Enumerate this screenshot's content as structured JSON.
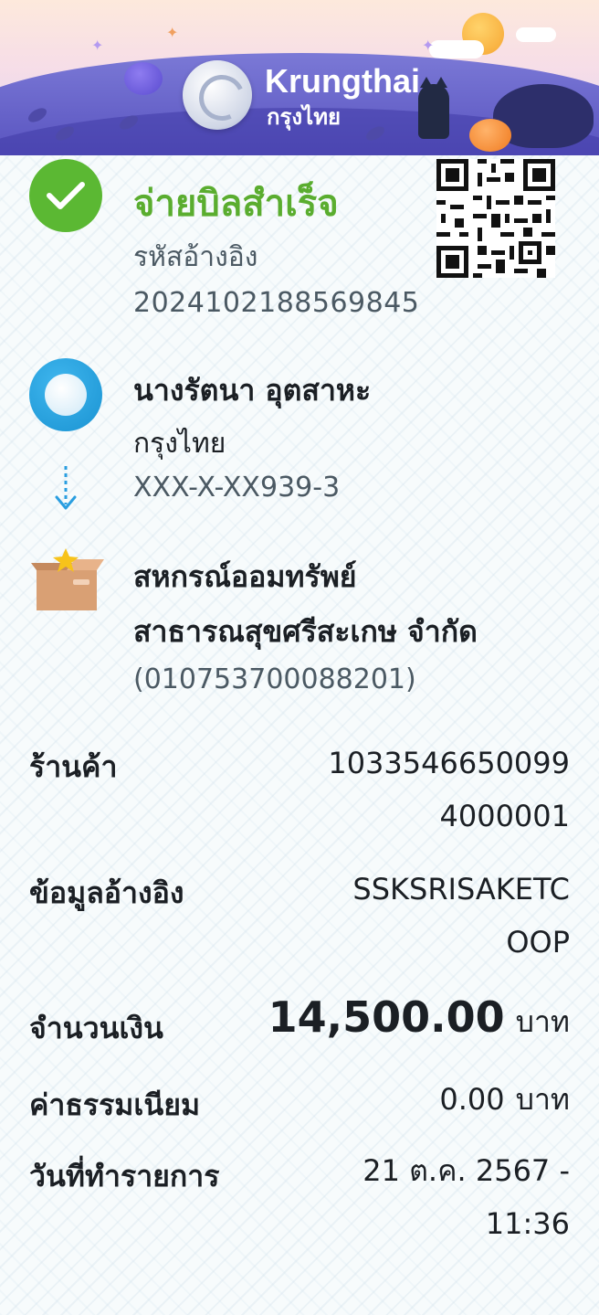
{
  "header": {
    "brand_en": "Krungthai",
    "brand_th": "กรุงไทย",
    "colors": {
      "banner_purple": "#5c57c2",
      "brand_text": "#ffffff"
    }
  },
  "status": {
    "title": "จ่ายบิลสำเร็จ",
    "icon": "check-circle-icon",
    "ref_label": "รหัสอ้างอิง",
    "ref_value": "2024102188569845",
    "color": "#5aad2f"
  },
  "from": {
    "name": "นางรัตนา อุตสาหะ",
    "bank": "กรุงไทย",
    "account": "XXX-X-XX939-3",
    "icon": "krungthai-logo-icon"
  },
  "biller": {
    "name_line1": "สหกรณ์ออมทรัพย์",
    "name_line2": "สาธารณสุขศรีสะเกษ จำกัด",
    "tax_id": "(010753700088201)",
    "icon": "box-star-icon"
  },
  "details": {
    "merchant_label": "ร้านค้า",
    "merchant_value_line1": "1033546650099",
    "merchant_value_line2": "4000001",
    "reference_label": "ข้อมูลอ้างอิง",
    "reference_value_line1": "SSKSRISAKETC",
    "reference_value_line2": "OOP",
    "amount_label": "จำนวนเงิน",
    "amount_value": "14,500.00",
    "amount_unit": "บาท",
    "fee_label": "ค่าธรรมเนียม",
    "fee_value": "0.00",
    "fee_unit": "บาท",
    "date_label": "วันที่ทำรายการ",
    "date_value_line1": "21 ต.ค. 2567 -",
    "date_value_line2": "11:36"
  }
}
